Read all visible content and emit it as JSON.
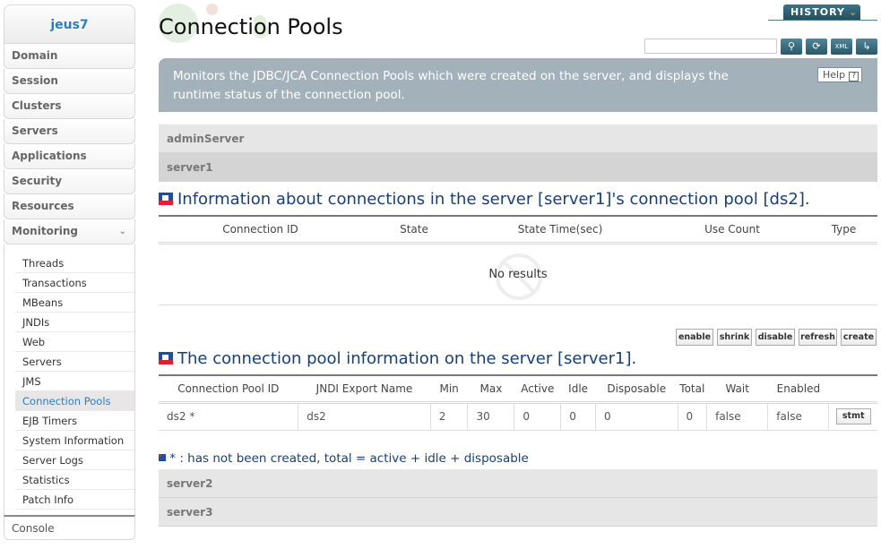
{
  "sidebar": {
    "header": "jeus7",
    "items": [
      {
        "label": "Domain"
      },
      {
        "label": "Session"
      },
      {
        "label": "Clusters"
      },
      {
        "label": "Servers"
      },
      {
        "label": "Applications"
      },
      {
        "label": "Security"
      },
      {
        "label": "Resources"
      },
      {
        "label": "Monitoring",
        "expanded": true
      }
    ],
    "sub_items": [
      {
        "label": "Threads"
      },
      {
        "label": "Transactions"
      },
      {
        "label": "MBeans"
      },
      {
        "label": "JNDIs"
      },
      {
        "label": "Web"
      },
      {
        "label": "Servers"
      },
      {
        "label": "JMS"
      },
      {
        "label": "Connection Pools",
        "active": true
      },
      {
        "label": "EJB Timers"
      },
      {
        "label": "System Information"
      },
      {
        "label": "Server Logs"
      },
      {
        "label": "Statistics"
      },
      {
        "label": "Patch Info"
      }
    ],
    "console": "Console",
    "chevron": "chevron-down-icon"
  },
  "header": {
    "title": "Connection Pools",
    "history_label": "HISTORY",
    "search_value": "",
    "toolbar_icons": [
      "search-icon",
      "reload-icon",
      "xml-export-icon",
      "restore-icon"
    ]
  },
  "banner": {
    "text": "Monitors the JDBC/JCA Connection Pools which were created on the server, and displays the runtime status of the connection pool.",
    "help_label": "Help",
    "help_icon": "?"
  },
  "servers_top": [
    "adminServer",
    "server1"
  ],
  "connections": {
    "title": "Information about connections in the server [server1]'s connection pool [ds2].",
    "columns": [
      "Connection ID",
      "State",
      "State Time(sec)",
      "Use Count",
      "Type"
    ],
    "empty_text": "No results"
  },
  "actions": [
    "enable",
    "shrink",
    "disable",
    "refresh",
    "create"
  ],
  "pools": {
    "title": "The connection pool information on the server [server1].",
    "columns": [
      "Connection Pool ID",
      "JNDI Export Name",
      "Min",
      "Max",
      "Active",
      "Idle",
      "Disposable",
      "Total",
      "Wait",
      "Enabled",
      ""
    ],
    "rows": [
      {
        "id": "ds2 *",
        "jndi": "ds2",
        "min": "2",
        "max": "30",
        "active": "0",
        "idle": "0",
        "disposable": "0",
        "total": "0",
        "wait": "false",
        "enabled": "false",
        "button": "stmt"
      }
    ]
  },
  "note": "* : has not been created, total = active + idle + disposable",
  "servers_bottom": [
    "server2",
    "server3"
  ]
}
